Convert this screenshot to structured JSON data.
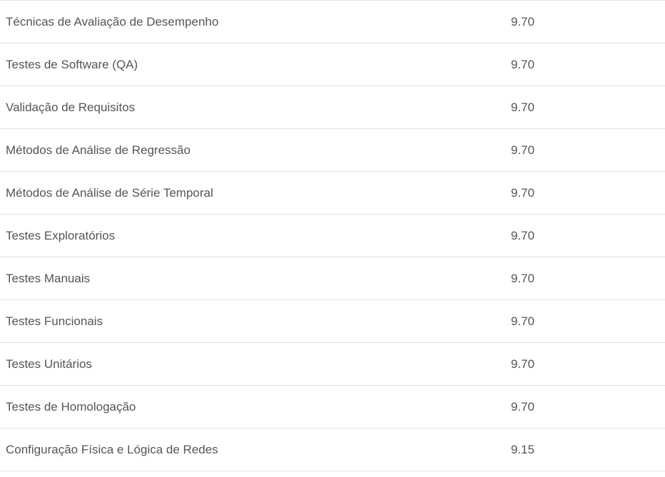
{
  "rows": [
    {
      "name": "Técnicas de Avaliação de Desempenho",
      "score": "9.70"
    },
    {
      "name": "Testes de Software (QA)",
      "score": "9.70"
    },
    {
      "name": "Validação de Requisitos",
      "score": "9.70"
    },
    {
      "name": "Métodos de Análise de Regressão",
      "score": "9.70"
    },
    {
      "name": "Métodos de Análise de Série Temporal",
      "score": "9.70"
    },
    {
      "name": "Testes Exploratórios",
      "score": "9.70"
    },
    {
      "name": "Testes Manuais",
      "score": "9.70"
    },
    {
      "name": "Testes Funcionais",
      "score": "9.70"
    },
    {
      "name": "Testes Unitários",
      "score": "9.70"
    },
    {
      "name": "Testes de Homologação",
      "score": "9.70"
    },
    {
      "name": "Configuração Física e Lógica de Redes",
      "score": "9.15"
    }
  ]
}
